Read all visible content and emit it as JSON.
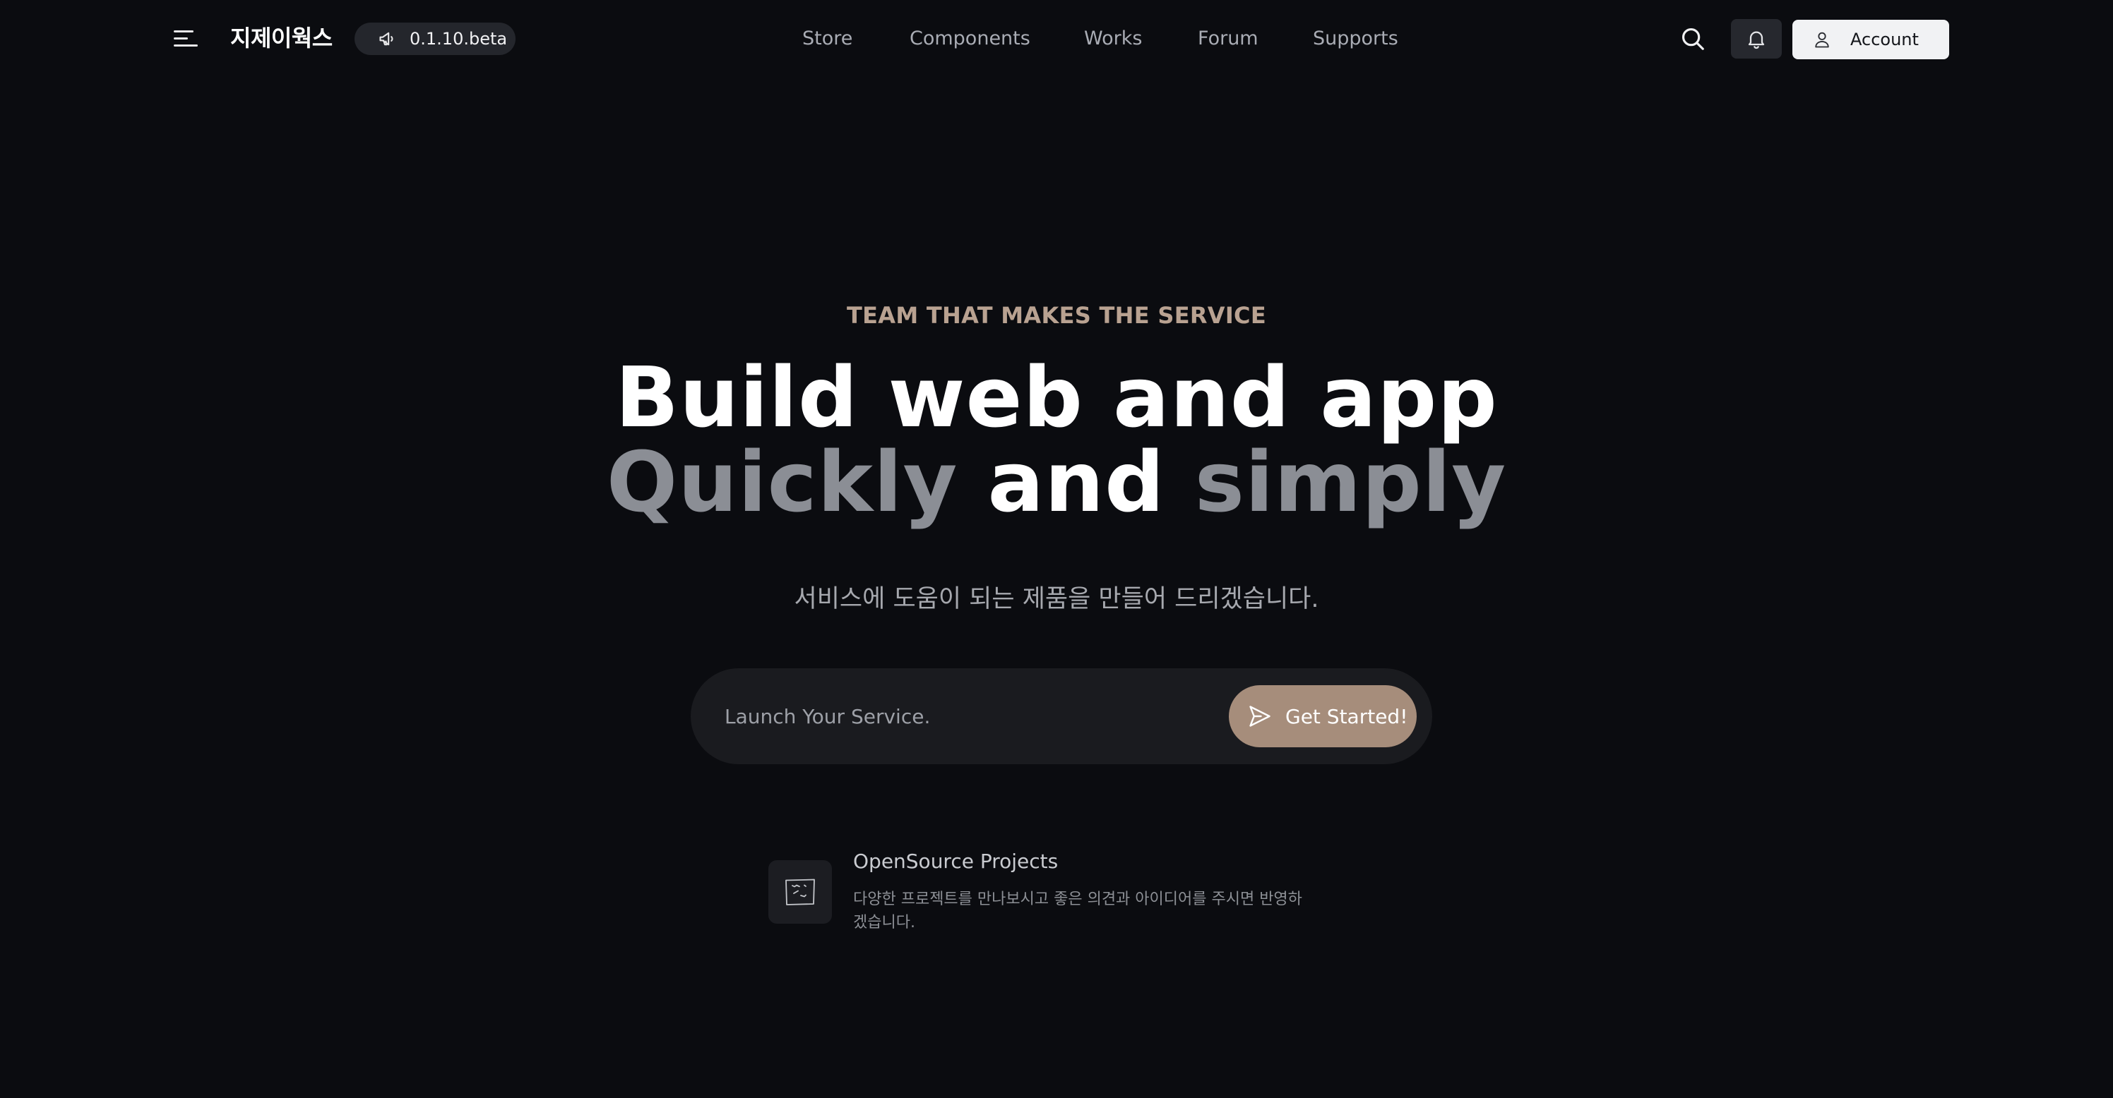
{
  "header": {
    "logo_text": "지제이웍스",
    "version_label": "0.1.10.beta",
    "nav": [
      {
        "label": "Store"
      },
      {
        "label": "Components"
      },
      {
        "label": "Works"
      },
      {
        "label": "Forum"
      },
      {
        "label": "Supports"
      }
    ],
    "account_label": "Account",
    "icons": {
      "menu": "hamburger-menu-icon",
      "version": "megaphone-icon",
      "search": "search-icon",
      "notifications": "bell-icon",
      "account": "user-icon"
    }
  },
  "hero": {
    "eyebrow": "TEAM THAT MAKES THE SERVICE",
    "headline_line1": "Build web and app",
    "headline_line2_part1": "Quickly",
    "headline_line2_part2": "and",
    "headline_line2_part3": "simply",
    "subtitle": "서비스에 도움이 되는 제품을 만들어 드리겠습니다.",
    "launch_placeholder": "Launch Your Service.",
    "launch_value": "",
    "cta_label": "Get Started!",
    "cta_icon": "send-icon"
  },
  "features": [
    {
      "icon": "sketch-frame-icon",
      "title": "OpenSource Projects",
      "description": "다양한 프로젝트를 만나보시고 좋은 의견과 아이디어를 주시면 반영하겠습니다."
    }
  ],
  "colors": {
    "background": "#0b0c10",
    "accent": "#a68d7b",
    "eyebrow": "#b9a291",
    "muted_headline": "#8b8e95",
    "nav_text": "#a9acb4"
  }
}
